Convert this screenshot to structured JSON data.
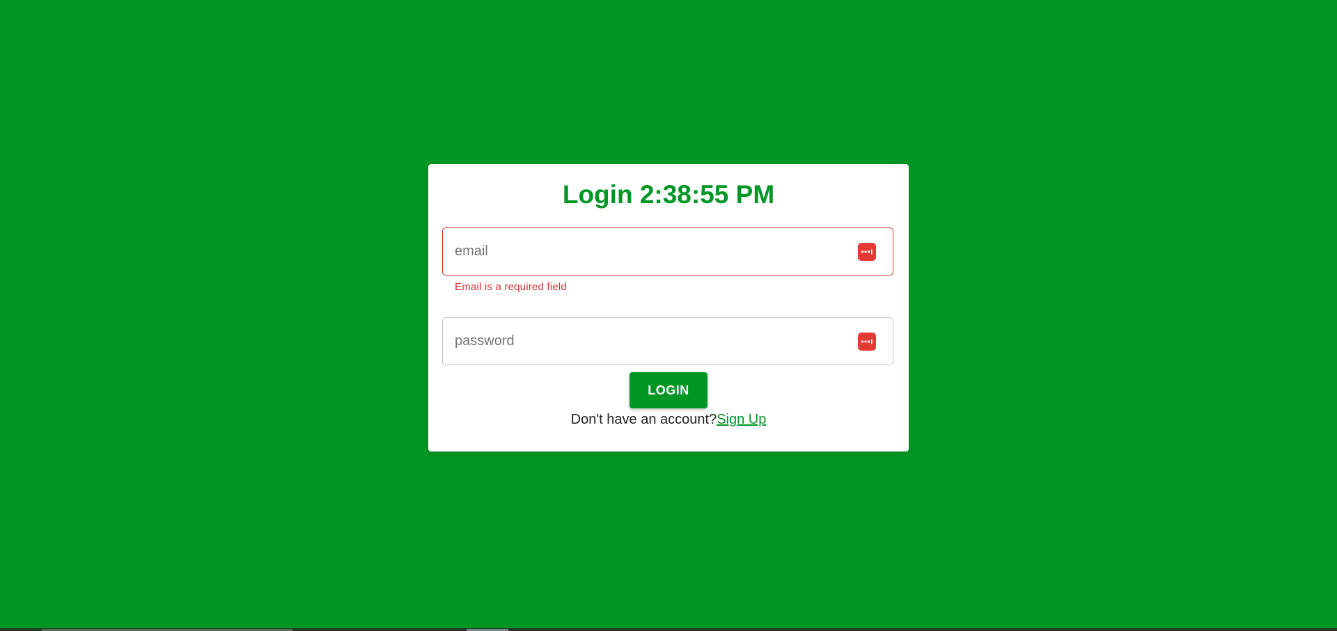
{
  "theme": {
    "background_color": "#009624",
    "accent_color": "#009624",
    "error_color": "#d32f2f",
    "password_manager_icon_color": "#e53935"
  },
  "login_form": {
    "title": "Login 2:38:55 PM",
    "email_field": {
      "placeholder": "email",
      "value": "",
      "error_text": "Email is a required field",
      "icon": "password-manager-icon"
    },
    "password_field": {
      "placeholder": "password",
      "value": "",
      "icon": "password-manager-icon"
    },
    "login_button_label": "LOGIN",
    "signup_prompt": "Don't have an account?",
    "signup_link_label": "Sign Up"
  }
}
